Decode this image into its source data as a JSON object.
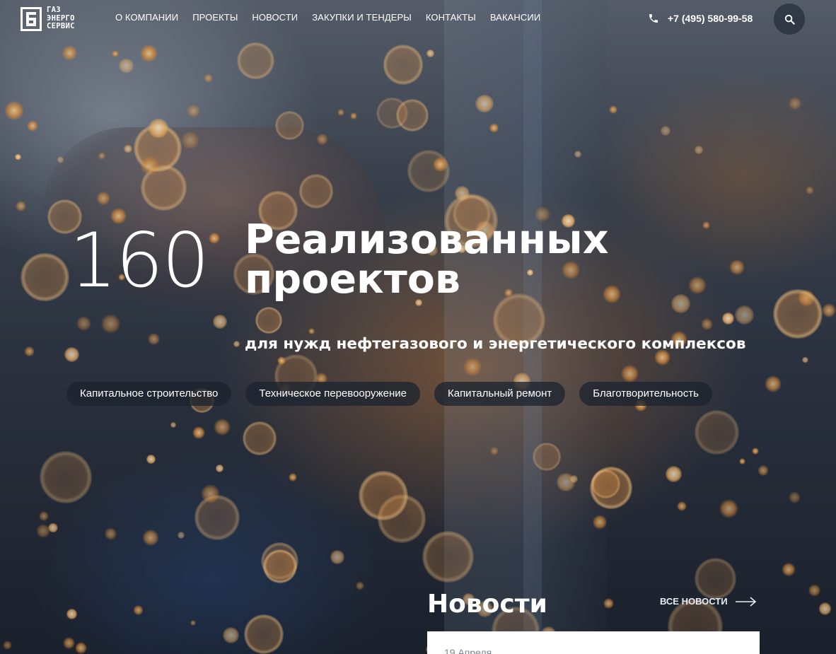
{
  "brand": {
    "logo_lines": [
      "ГАЗ",
      "ЭНЕРГО",
      "СЕРВИС"
    ],
    "logo_icon": "logo-mark-icon"
  },
  "nav": {
    "items": [
      {
        "label": "О КОМПАНИИ"
      },
      {
        "label": "ПРОЕКТЫ"
      },
      {
        "label": "НОВОСТИ"
      },
      {
        "label": "ЗАКУПКИ И ТЕНДЕРЫ"
      },
      {
        "label": "КОНТАКТЫ"
      },
      {
        "label": "ВАКАНСИИ"
      }
    ]
  },
  "contact": {
    "phone_icon": "phone-icon",
    "phone": "+7 (495) 580-99-58"
  },
  "search": {
    "icon": "search-icon"
  },
  "hero": {
    "count": "160",
    "headline_lines": [
      "Реализованных",
      "проектов"
    ],
    "subheadline": "для нужд нефтегазового и энергетического комплексов",
    "tags": [
      {
        "label": "Капитальное строительство"
      },
      {
        "label": "Техническое перевооружение"
      },
      {
        "label": "Капитальный ремонт"
      },
      {
        "label": "Благотворительность"
      }
    ]
  },
  "news": {
    "title": "Новости",
    "all_link": "ВСЕ НОВОСТИ",
    "arrow_icon": "arrow-right-icon",
    "items": [
      {
        "date": "19 Апреля"
      }
    ]
  },
  "colors": {
    "text": "#ffffff",
    "chip_bg": "#1c2430",
    "card_bg": "#ffffff",
    "date_text": "#7f8792",
    "spark": "#ec963c"
  }
}
